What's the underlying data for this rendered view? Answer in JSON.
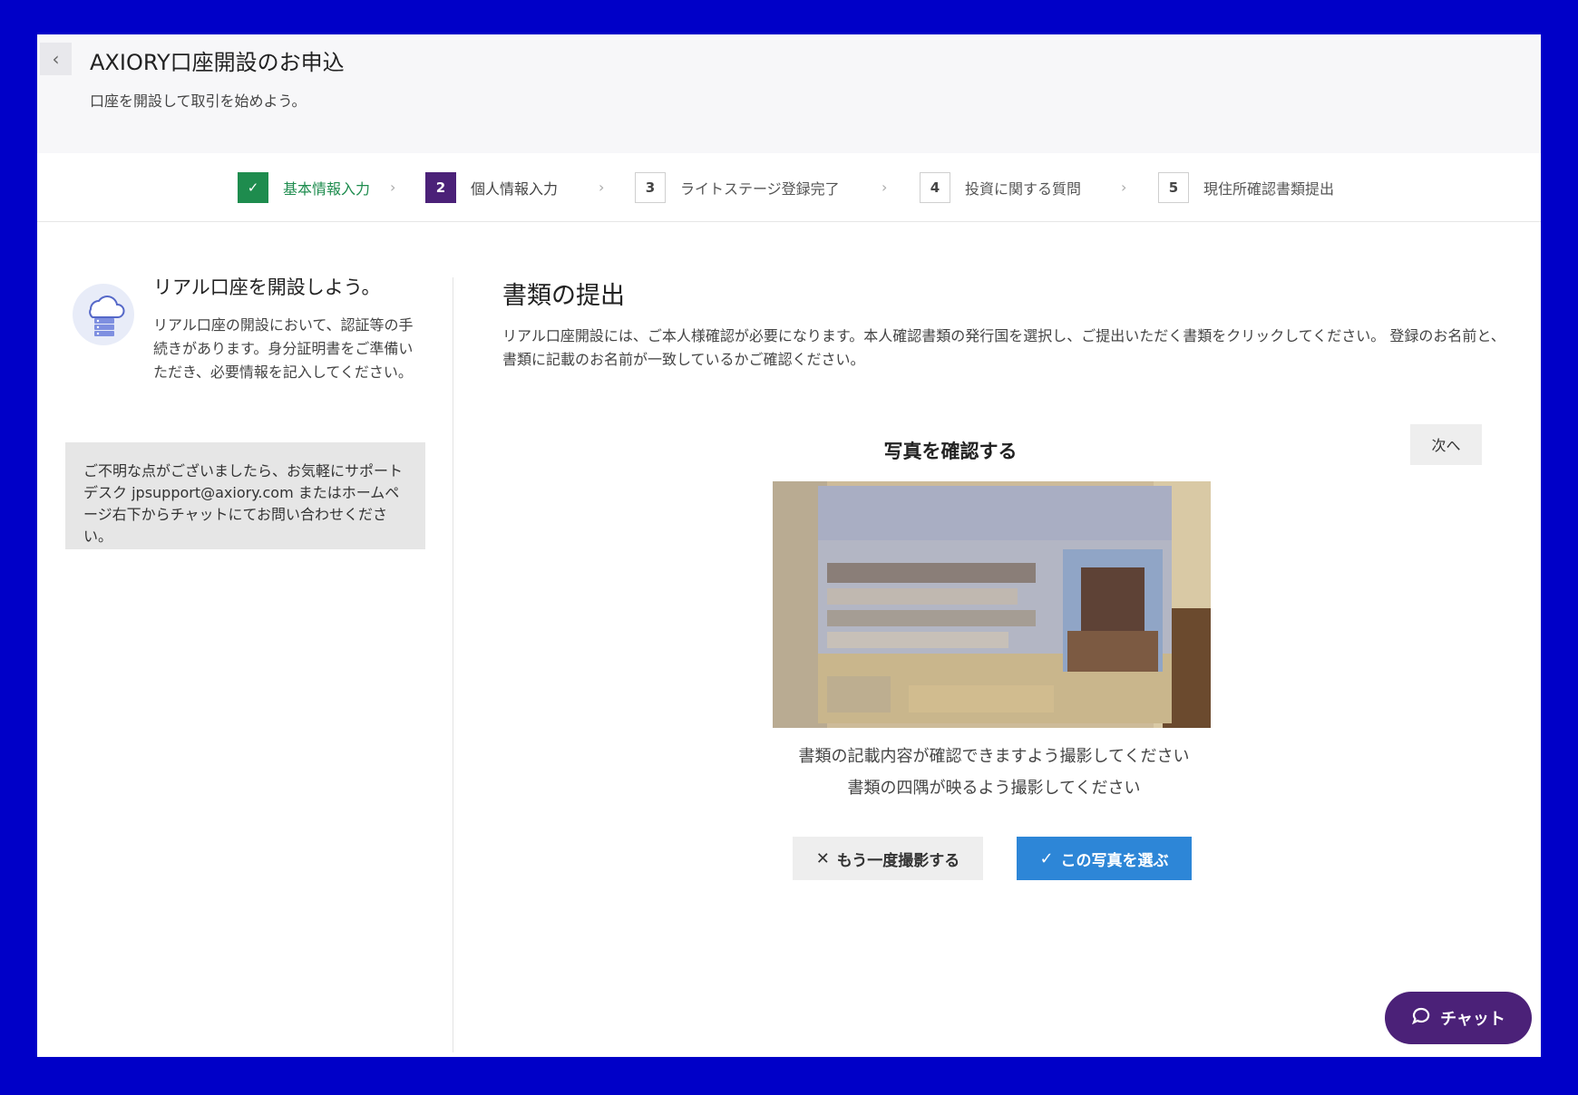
{
  "header": {
    "back_icon": "chevron-left-icon",
    "title": "AXIORY口座開設のお申込",
    "subtitle": "口座を開設して取引を始めよう。"
  },
  "steps": [
    {
      "number": "✓",
      "label": "基本情報入力",
      "state": "done"
    },
    {
      "number": "2",
      "label": "個人情報入力",
      "state": "active"
    },
    {
      "number": "3",
      "label": "ライトステージ登録完了",
      "state": "todo"
    },
    {
      "number": "4",
      "label": "投資に関する質問",
      "state": "todo"
    },
    {
      "number": "5",
      "label": "現住所確認書類提出",
      "state": "todo"
    }
  ],
  "step_separator": "›",
  "sidebar": {
    "promo_title": "リアル口座を開設しよう。",
    "promo_text": "リアル口座の開設において、認証等の手続きがあります。身分証明書をご準備いただき、必要情報を記入してください。",
    "help_text": "ご不明な点がございましたら、お気軽にサポートデスク jpsupport@axiory.com またはホームページ右下からチャットにてお問い合わせください。"
  },
  "main": {
    "title": "書類の提出",
    "description": "リアル口座開設には、ご本人様確認が必要になります。本人確認書類の発行国を選択し、ご提出いただく書類をクリックしてください。 登録のお名前と、書類に記載のお名前が一致しているかご確認ください。",
    "next_label": "次へ",
    "confirm_title": "写真を確認する",
    "hint_1": "書類の記載内容が確認できますよう撮影してください",
    "hint_2": "書類の四隅が映るよう撮影してください",
    "retake_label": "もう一度撮影する",
    "choose_label": "この写真を選ぶ"
  },
  "chat": {
    "label": "チャット"
  },
  "colors": {
    "frame": "#0000c8",
    "done_step": "#1e8c4e",
    "active_step": "#4b2178",
    "primary_button": "#2d86d7",
    "chat_button": "#4b2178"
  }
}
